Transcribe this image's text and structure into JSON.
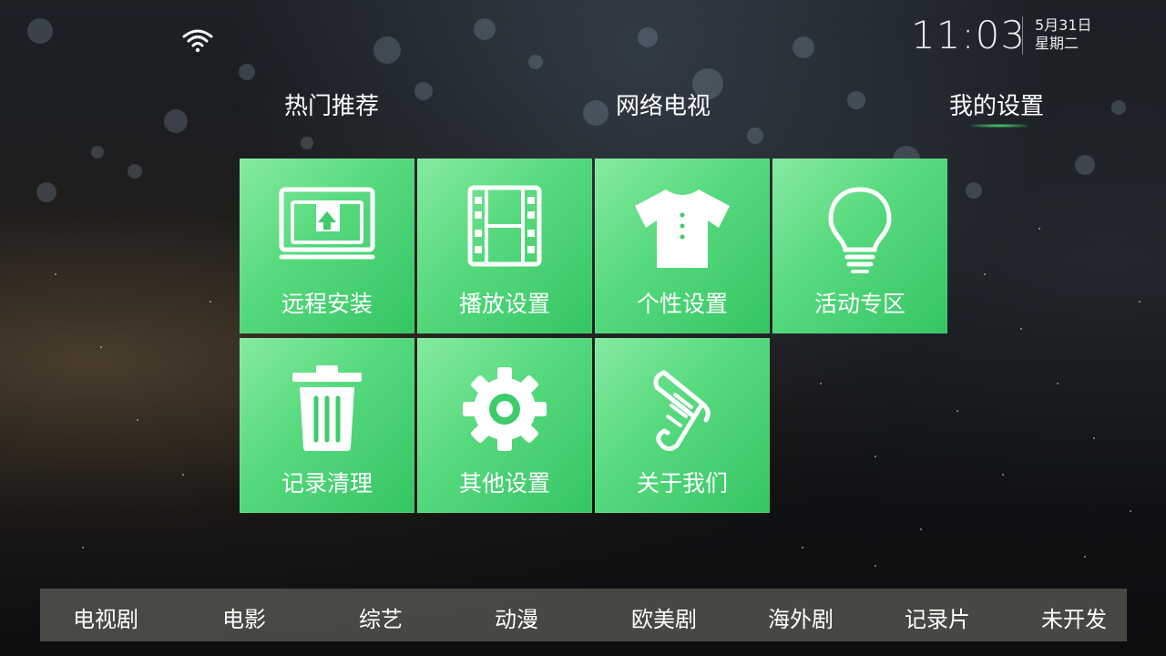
{
  "status_bar": {
    "wifi_icon": "wifi-icon",
    "time": "11:03",
    "date": "5月31日",
    "weekday": "星期二"
  },
  "tabs": [
    {
      "label": "热门推荐",
      "selected": false
    },
    {
      "label": "网络电视",
      "selected": false
    },
    {
      "label": "我的设置",
      "selected": true
    }
  ],
  "tiles": [
    {
      "label": "远程安装",
      "icon": "remote-install-icon"
    },
    {
      "label": "播放设置",
      "icon": "film-icon"
    },
    {
      "label": "个性设置",
      "icon": "tshirt-icon"
    },
    {
      "label": "活动专区",
      "icon": "lightbulb-icon"
    },
    {
      "label": "记录清理",
      "icon": "trash-icon"
    },
    {
      "label": "其他设置",
      "icon": "gear-icon"
    },
    {
      "label": "关于我们",
      "icon": "scroll-icon"
    }
  ],
  "bottom_nav": [
    "电视剧",
    "电影",
    "综艺",
    "动漫",
    "欧美剧",
    "海外剧",
    "记录片",
    "未开发"
  ],
  "colors": {
    "tile_green": "#55d97d",
    "tab_indicator": "#4be07b"
  }
}
